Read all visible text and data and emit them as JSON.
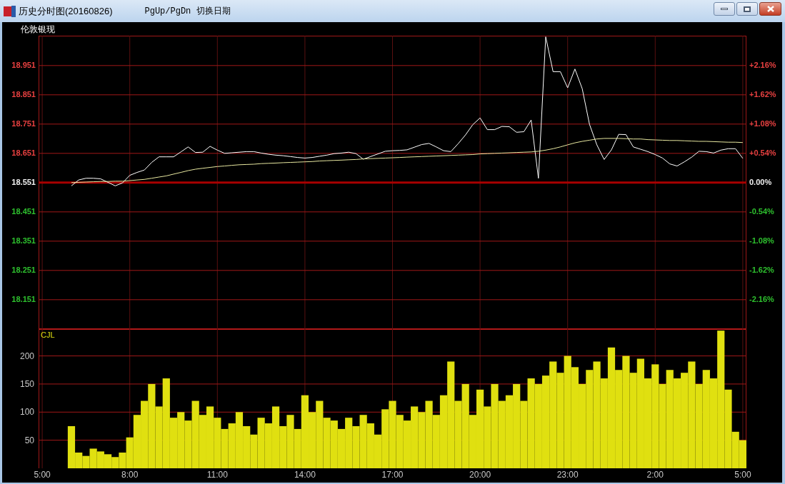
{
  "window": {
    "title": "历史分时图(20160826)",
    "hint": "PgUp/PgDn 切换日期"
  },
  "instrument": "伦敦银现",
  "price_chart": {
    "chart_data": {
      "type": "line",
      "grid": true,
      "ylim": [
        18.053,
        19.053
      ],
      "ref_lines": [
        {
          "axis": "y",
          "value": 18.551
        }
      ],
      "categories": [
        null,
        null,
        null,
        null,
        null,
        null,
        null,
        null,
        null,
        null,
        null,
        null,
        null,
        null,
        null,
        null,
        null,
        null,
        null,
        null,
        null,
        null,
        null,
        null,
        null,
        null,
        null,
        null,
        null,
        null,
        null,
        null,
        null,
        null,
        null,
        null,
        null,
        null,
        null,
        null,
        null,
        null,
        null,
        null,
        null,
        null,
        null,
        null,
        null,
        null,
        null,
        null,
        null,
        null,
        null,
        null,
        null,
        null,
        null,
        null,
        null,
        null,
        null,
        null,
        null,
        null,
        null,
        null,
        null,
        null,
        null,
        null,
        null,
        null,
        null,
        null,
        null,
        null,
        null,
        null,
        null,
        null,
        null,
        null,
        null,
        null,
        null,
        null,
        null,
        null,
        null,
        null,
        null,
        null,
        null,
        null,
        null
      ],
      "series": [
        {
          "color": "#ffffff",
          "values": [
            null,
            null,
            null,
            null,
            18.54,
            18.56,
            18.566,
            18.566,
            18.564,
            18.552,
            18.54,
            18.55,
            18.576,
            18.586,
            18.594,
            18.62,
            18.639,
            18.639,
            18.639,
            18.656,
            18.673,
            18.654,
            18.655,
            18.675,
            18.662,
            18.651,
            18.653,
            18.655,
            18.657,
            18.657,
            18.652,
            18.648,
            18.645,
            18.643,
            18.64,
            18.637,
            18.635,
            18.637,
            18.641,
            18.645,
            18.65,
            18.652,
            18.655,
            18.65,
            18.631,
            18.64,
            18.649,
            18.658,
            18.66,
            18.661,
            18.663,
            18.672,
            18.681,
            18.685,
            18.673,
            18.66,
            18.657,
            18.684,
            18.714,
            18.749,
            18.772,
            18.732,
            18.732,
            18.743,
            18.742,
            18.723,
            18.725,
            18.765,
            18.566,
            19.049,
            18.93,
            18.93,
            18.875,
            18.939,
            18.872,
            18.75,
            18.68,
            18.63,
            18.663,
            18.716,
            18.715,
            18.673,
            18.665,
            18.657,
            18.647,
            18.635,
            18.615,
            18.608,
            18.622,
            18.638,
            18.658,
            18.657,
            18.652,
            18.662,
            18.667,
            18.667,
            18.634
          ]
        },
        {
          "color": "#e8e8a0",
          "values": [
            null,
            null,
            null,
            null,
            18.551,
            18.552,
            18.553,
            18.554,
            18.555,
            18.555,
            18.556,
            18.556,
            18.558,
            18.56,
            18.562,
            18.566,
            18.57,
            18.574,
            18.58,
            18.586,
            18.592,
            18.597,
            18.6,
            18.603,
            18.606,
            18.608,
            18.61,
            18.612,
            18.613,
            18.614,
            18.616,
            18.617,
            18.618,
            18.619,
            18.62,
            18.621,
            18.622,
            18.623,
            18.625,
            18.626,
            18.627,
            18.628,
            18.629,
            18.63,
            18.632,
            18.633,
            18.634,
            18.635,
            18.636,
            18.637,
            18.638,
            18.639,
            18.64,
            18.641,
            18.642,
            18.643,
            18.644,
            18.645,
            18.646,
            18.647,
            18.649,
            18.65,
            18.651,
            18.652,
            18.653,
            18.654,
            18.655,
            18.656,
            18.658,
            18.662,
            18.667,
            18.673,
            18.68,
            18.687,
            18.692,
            18.696,
            18.7,
            18.702,
            18.702,
            18.702,
            18.701,
            18.7,
            18.7,
            18.698,
            18.697,
            18.696,
            18.695,
            18.695,
            18.694,
            18.693,
            18.692,
            18.692,
            18.691,
            18.69,
            18.689,
            18.689,
            18.688
          ]
        }
      ],
      "yticks": [
        {
          "value": 18.951,
          "label": "18.951"
        },
        {
          "value": 18.851,
          "label": "18.851"
        },
        {
          "value": 18.751,
          "label": "18.751"
        },
        {
          "value": 18.651,
          "label": "18.651"
        },
        {
          "value": 18.551,
          "label": "18.551"
        },
        {
          "value": 18.451,
          "label": "18.451"
        },
        {
          "value": 18.351,
          "label": "18.351"
        },
        {
          "value": 18.251,
          "label": "18.251"
        },
        {
          "value": 18.151,
          "label": "18.151"
        }
      ]
    },
    "right_ticks": [
      {
        "label": "+2.16%",
        "kind": "up"
      },
      {
        "label": "+1.62%",
        "kind": "up"
      },
      {
        "label": "+1.08%",
        "kind": "up"
      },
      {
        "label": "+0.54%",
        "kind": "up"
      },
      {
        "label": "0.00%",
        "kind": "flat"
      },
      {
        "label": "-0.54%",
        "kind": "down"
      },
      {
        "label": "-1.08%",
        "kind": "down"
      },
      {
        "label": "-1.62%",
        "kind": "down"
      },
      {
        "label": "-2.16%",
        "kind": "down"
      }
    ]
  },
  "volume_chart": {
    "chart_data": {
      "type": "bar",
      "grid": true,
      "ylim": [
        0,
        249
      ],
      "categories": [
        "5:00",
        null,
        null,
        null,
        null,
        null,
        null,
        null,
        null,
        null,
        null,
        null,
        "8:00",
        null,
        null,
        null,
        null,
        null,
        null,
        null,
        null,
        null,
        null,
        null,
        "11:00",
        null,
        null,
        null,
        null,
        null,
        null,
        null,
        null,
        null,
        null,
        null,
        "14:00",
        null,
        null,
        null,
        null,
        null,
        null,
        null,
        null,
        null,
        null,
        null,
        "17:00",
        null,
        null,
        null,
        null,
        null,
        null,
        null,
        null,
        null,
        null,
        null,
        "20:00",
        null,
        null,
        null,
        null,
        null,
        null,
        null,
        null,
        null,
        null,
        null,
        "23:00",
        null,
        null,
        null,
        null,
        null,
        null,
        null,
        null,
        null,
        null,
        null,
        "2:00",
        null,
        null,
        null,
        null,
        null,
        null,
        null,
        null,
        null,
        null,
        null,
        "5:00"
      ],
      "series": [
        {
          "name": "CJL",
          "color": "#e0e010",
          "values": [
            null,
            null,
            null,
            null,
            75,
            28,
            22,
            35,
            30,
            25,
            20,
            28,
            55,
            95,
            120,
            150,
            110,
            160,
            90,
            100,
            85,
            120,
            95,
            110,
            90,
            70,
            80,
            100,
            75,
            60,
            90,
            80,
            110,
            75,
            95,
            70,
            130,
            100,
            120,
            90,
            85,
            70,
            90,
            75,
            95,
            80,
            60,
            105,
            120,
            95,
            85,
            110,
            100,
            120,
            95,
            130,
            190,
            120,
            150,
            95,
            140,
            110,
            150,
            120,
            130,
            150,
            120,
            160,
            150,
            165,
            190,
            170,
            200,
            180,
            150,
            175,
            190,
            160,
            215,
            175,
            200,
            170,
            195,
            160,
            185,
            150,
            175,
            160,
            170,
            190,
            150,
            175,
            160,
            245,
            140,
            65,
            50
          ]
        }
      ],
      "yticks": [
        {
          "value": 200,
          "label": "200"
        },
        {
          "value": 150,
          "label": "150"
        },
        {
          "value": 100,
          "label": "100"
        },
        {
          "value": 50,
          "label": "50"
        }
      ]
    }
  }
}
